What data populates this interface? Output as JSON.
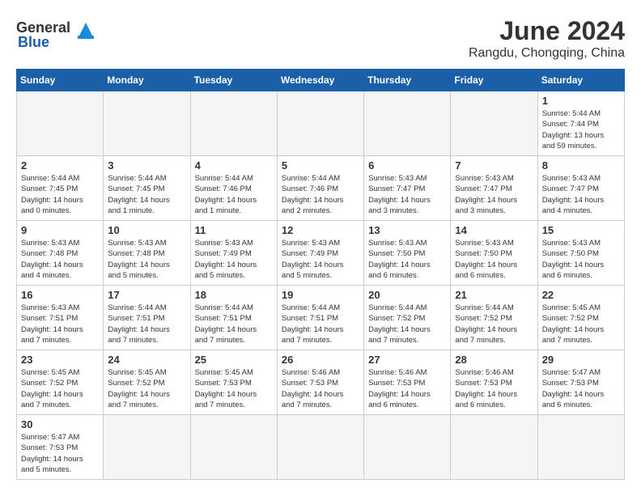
{
  "header": {
    "logo_general": "General",
    "logo_blue": "Blue",
    "month_year": "June 2024",
    "location": "Rangdu, Chongqing, China"
  },
  "weekdays": [
    "Sunday",
    "Monday",
    "Tuesday",
    "Wednesday",
    "Thursday",
    "Friday",
    "Saturday"
  ],
  "weeks": [
    [
      {
        "day": "",
        "info": ""
      },
      {
        "day": "",
        "info": ""
      },
      {
        "day": "",
        "info": ""
      },
      {
        "day": "",
        "info": ""
      },
      {
        "day": "",
        "info": ""
      },
      {
        "day": "",
        "info": ""
      },
      {
        "day": "1",
        "info": "Sunrise: 5:44 AM\nSunset: 7:44 PM\nDaylight: 13 hours\nand 59 minutes."
      }
    ],
    [
      {
        "day": "2",
        "info": "Sunrise: 5:44 AM\nSunset: 7:45 PM\nDaylight: 14 hours\nand 0 minutes."
      },
      {
        "day": "3",
        "info": "Sunrise: 5:44 AM\nSunset: 7:45 PM\nDaylight: 14 hours\nand 1 minute."
      },
      {
        "day": "4",
        "info": "Sunrise: 5:44 AM\nSunset: 7:46 PM\nDaylight: 14 hours\nand 1 minute."
      },
      {
        "day": "5",
        "info": "Sunrise: 5:44 AM\nSunset: 7:46 PM\nDaylight: 14 hours\nand 2 minutes."
      },
      {
        "day": "6",
        "info": "Sunrise: 5:43 AM\nSunset: 7:47 PM\nDaylight: 14 hours\nand 3 minutes."
      },
      {
        "day": "7",
        "info": "Sunrise: 5:43 AM\nSunset: 7:47 PM\nDaylight: 14 hours\nand 3 minutes."
      },
      {
        "day": "8",
        "info": "Sunrise: 5:43 AM\nSunset: 7:47 PM\nDaylight: 14 hours\nand 4 minutes."
      }
    ],
    [
      {
        "day": "9",
        "info": "Sunrise: 5:43 AM\nSunset: 7:48 PM\nDaylight: 14 hours\nand 4 minutes."
      },
      {
        "day": "10",
        "info": "Sunrise: 5:43 AM\nSunset: 7:48 PM\nDaylight: 14 hours\nand 5 minutes."
      },
      {
        "day": "11",
        "info": "Sunrise: 5:43 AM\nSunset: 7:49 PM\nDaylight: 14 hours\nand 5 minutes."
      },
      {
        "day": "12",
        "info": "Sunrise: 5:43 AM\nSunset: 7:49 PM\nDaylight: 14 hours\nand 5 minutes."
      },
      {
        "day": "13",
        "info": "Sunrise: 5:43 AM\nSunset: 7:50 PM\nDaylight: 14 hours\nand 6 minutes."
      },
      {
        "day": "14",
        "info": "Sunrise: 5:43 AM\nSunset: 7:50 PM\nDaylight: 14 hours\nand 6 minutes."
      },
      {
        "day": "15",
        "info": "Sunrise: 5:43 AM\nSunset: 7:50 PM\nDaylight: 14 hours\nand 6 minutes."
      }
    ],
    [
      {
        "day": "16",
        "info": "Sunrise: 5:43 AM\nSunset: 7:51 PM\nDaylight: 14 hours\nand 7 minutes."
      },
      {
        "day": "17",
        "info": "Sunrise: 5:44 AM\nSunset: 7:51 PM\nDaylight: 14 hours\nand 7 minutes."
      },
      {
        "day": "18",
        "info": "Sunrise: 5:44 AM\nSunset: 7:51 PM\nDaylight: 14 hours\nand 7 minutes."
      },
      {
        "day": "19",
        "info": "Sunrise: 5:44 AM\nSunset: 7:51 PM\nDaylight: 14 hours\nand 7 minutes."
      },
      {
        "day": "20",
        "info": "Sunrise: 5:44 AM\nSunset: 7:52 PM\nDaylight: 14 hours\nand 7 minutes."
      },
      {
        "day": "21",
        "info": "Sunrise: 5:44 AM\nSunset: 7:52 PM\nDaylight: 14 hours\nand 7 minutes."
      },
      {
        "day": "22",
        "info": "Sunrise: 5:45 AM\nSunset: 7:52 PM\nDaylight: 14 hours\nand 7 minutes."
      }
    ],
    [
      {
        "day": "23",
        "info": "Sunrise: 5:45 AM\nSunset: 7:52 PM\nDaylight: 14 hours\nand 7 minutes."
      },
      {
        "day": "24",
        "info": "Sunrise: 5:45 AM\nSunset: 7:52 PM\nDaylight: 14 hours\nand 7 minutes."
      },
      {
        "day": "25",
        "info": "Sunrise: 5:45 AM\nSunset: 7:53 PM\nDaylight: 14 hours\nand 7 minutes."
      },
      {
        "day": "26",
        "info": "Sunrise: 5:46 AM\nSunset: 7:53 PM\nDaylight: 14 hours\nand 7 minutes."
      },
      {
        "day": "27",
        "info": "Sunrise: 5:46 AM\nSunset: 7:53 PM\nDaylight: 14 hours\nand 6 minutes."
      },
      {
        "day": "28",
        "info": "Sunrise: 5:46 AM\nSunset: 7:53 PM\nDaylight: 14 hours\nand 6 minutes."
      },
      {
        "day": "29",
        "info": "Sunrise: 5:47 AM\nSunset: 7:53 PM\nDaylight: 14 hours\nand 6 minutes."
      }
    ],
    [
      {
        "day": "30",
        "info": "Sunrise: 5:47 AM\nSunset: 7:53 PM\nDaylight: 14 hours\nand 5 minutes."
      },
      {
        "day": "",
        "info": ""
      },
      {
        "day": "",
        "info": ""
      },
      {
        "day": "",
        "info": ""
      },
      {
        "day": "",
        "info": ""
      },
      {
        "day": "",
        "info": ""
      },
      {
        "day": "",
        "info": ""
      }
    ]
  ]
}
